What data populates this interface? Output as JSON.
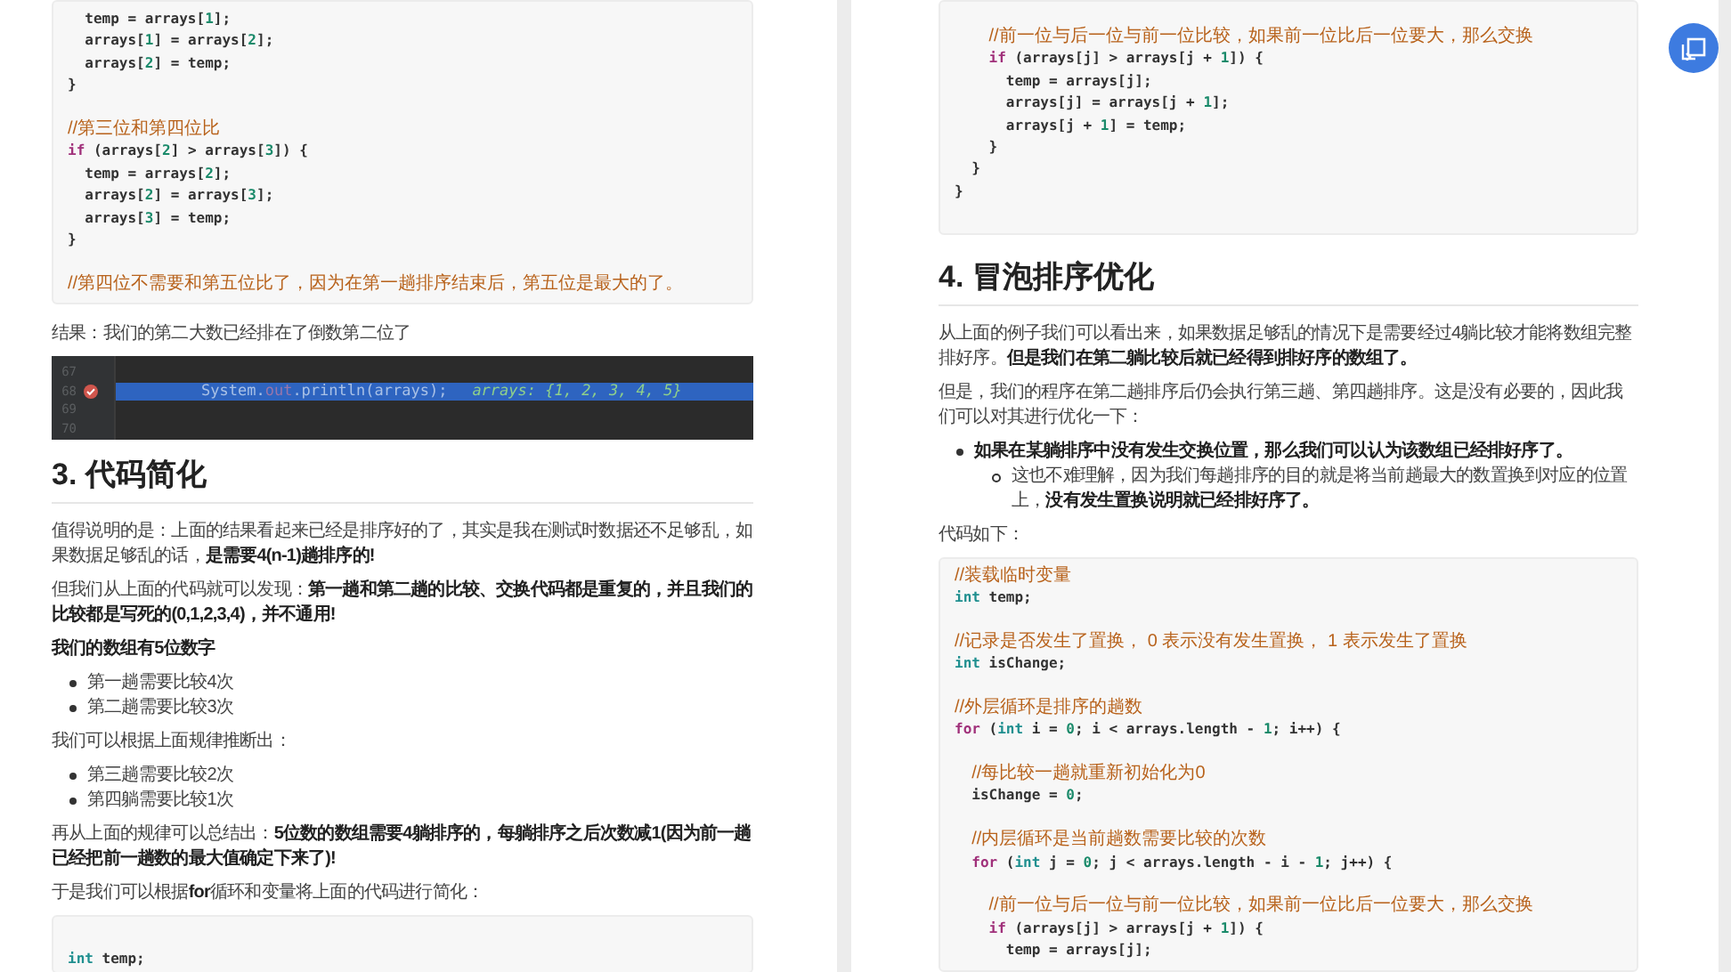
{
  "pages": [
    {
      "blocks": [
        {
          "kind": "code",
          "lines": [
            {
              "kind": "code",
              "tokens": [
                {
                  "kind": "plain",
                  "text": "  temp = arrays["
                },
                {
                  "kind": "num",
                  "text": "1"
                },
                {
                  "kind": "plain",
                  "text": "];"
                }
              ]
            },
            {
              "kind": "code",
              "tokens": [
                {
                  "kind": "plain",
                  "text": "  arrays["
                },
                {
                  "kind": "num",
                  "text": "1"
                },
                {
                  "kind": "plain",
                  "text": "] = arrays["
                },
                {
                  "kind": "num",
                  "text": "2"
                },
                {
                  "kind": "plain",
                  "text": "];"
                }
              ]
            },
            {
              "kind": "code",
              "tokens": [
                {
                  "kind": "plain",
                  "text": "  arrays["
                },
                {
                  "kind": "num",
                  "text": "2"
                },
                {
                  "kind": "plain",
                  "text": "] = temp;"
                }
              ]
            },
            {
              "kind": "code",
              "tokens": [
                {
                  "kind": "plain",
                  "text": "}"
                }
              ]
            },
            {
              "kind": "blank"
            },
            {
              "kind": "code",
              "tokens": [
                {
                  "kind": "comment",
                  "text": "//第三位和第四位比"
                }
              ]
            },
            {
              "kind": "code",
              "tokens": [
                {
                  "kind": "kw",
                  "text": "if"
                },
                {
                  "kind": "plain",
                  "text": " (arrays["
                },
                {
                  "kind": "num",
                  "text": "2"
                },
                {
                  "kind": "plain",
                  "text": "] > arrays["
                },
                {
                  "kind": "num",
                  "text": "3"
                },
                {
                  "kind": "plain",
                  "text": "]) {"
                }
              ]
            },
            {
              "kind": "code",
              "tokens": [
                {
                  "kind": "plain",
                  "text": "  temp = arrays["
                },
                {
                  "kind": "num",
                  "text": "2"
                },
                {
                  "kind": "plain",
                  "text": "];"
                }
              ]
            },
            {
              "kind": "code",
              "tokens": [
                {
                  "kind": "plain",
                  "text": "  arrays["
                },
                {
                  "kind": "num",
                  "text": "2"
                },
                {
                  "kind": "plain",
                  "text": "] = arrays["
                },
                {
                  "kind": "num",
                  "text": "3"
                },
                {
                  "kind": "plain",
                  "text": "];"
                }
              ]
            },
            {
              "kind": "code",
              "tokens": [
                {
                  "kind": "plain",
                  "text": "  arrays["
                },
                {
                  "kind": "num",
                  "text": "3"
                },
                {
                  "kind": "plain",
                  "text": "] = temp;"
                }
              ]
            },
            {
              "kind": "code",
              "tokens": [
                {
                  "kind": "plain",
                  "text": "}"
                }
              ]
            },
            {
              "kind": "blank"
            },
            {
              "kind": "code",
              "tokens": [
                {
                  "kind": "comment",
                  "text": "//第四位不需要和第五位比了，因为在第一趟排序结束后，第五位是最大的了。"
                }
              ]
            }
          ]
        },
        {
          "kind": "paragraph",
          "text": "结果：我们的第二大数已经排在了倒数第二位了"
        },
        {
          "kind": "editor",
          "lines": [
            {
              "number": "67",
              "breakpoint": false,
              "highlighted": false
            },
            {
              "number": "68",
              "breakpoint": true,
              "highlighted": true,
              "code": [
                {
                  "kind": "plain",
                  "text": "System."
                },
                {
                  "kind": "field",
                  "text": "out"
                },
                {
                  "kind": "plain",
                  "text": ".println(arrays);"
                }
              ],
              "value": "arrays: {1, 2, 3, 4, 5}"
            },
            {
              "number": "69",
              "breakpoint": false,
              "highlighted": false
            },
            {
              "number": "70",
              "breakpoint": false,
              "highlighted": false
            }
          ]
        },
        {
          "kind": "heading",
          "text": "3. 代码简化"
        },
        {
          "kind": "paragraph",
          "text": "值得说明的是：上面的结果看起来已经是排序好的了，其实是我在测试时数据还不足够乱，如果数据足够乱的话，**是需要4(n-1)趟排序的!**"
        },
        {
          "kind": "paragraph",
          "text": "但我们从上面的代码就可以发现：**第一趟和第二趟的比较、交换代码都是重复的，并且我们的比较都是写死的(0,1,2,3,4)，并不通用!**"
        },
        {
          "kind": "paragraph",
          "text": "**我们的数组有5位数字**"
        },
        {
          "kind": "list",
          "items": [
            {
              "text": "第一趟需要比较4次"
            },
            {
              "text": "第二趟需要比较3次"
            }
          ]
        },
        {
          "kind": "paragraph",
          "text": "我们可以根据上面规律推断出："
        },
        {
          "kind": "list",
          "items": [
            {
              "text": "第三趟需要比较2次"
            },
            {
              "text": "第四躺需要比较1次"
            }
          ]
        },
        {
          "kind": "paragraph",
          "text": "再从上面的规律可以总结出：**5位数的数组需要4躺排序的，每躺排序之后次数减1(因为前一趟已经把前一趟数的最大值确定下来了)!**"
        },
        {
          "kind": "paragraph",
          "text": "于是我们可以根据**for**循环和变量将上面的代码进行简化："
        },
        {
          "kind": "code",
          "lines": [
            {
              "kind": "blank"
            },
            {
              "kind": "code",
              "tokens": [
                {
                  "kind": "type",
                  "text": "int"
                },
                {
                  "kind": "plain",
                  "text": " temp;"
                }
              ]
            }
          ]
        }
      ]
    },
    {
      "blocks": [
        {
          "kind": "code",
          "lines": [
            {
              "kind": "code",
              "tokens": [
                {
                  "kind": "comment",
                  "text": "    //前一位与后一位与前一位比较，如果前一位比后一位要大，那么交换"
                }
              ]
            },
            {
              "kind": "code",
              "tokens": [
                {
                  "kind": "kw",
                  "text": "    if"
                },
                {
                  "kind": "plain",
                  "text": " (arrays[j] > arrays[j + "
                },
                {
                  "kind": "num",
                  "text": "1"
                },
                {
                  "kind": "plain",
                  "text": "]) {"
                }
              ]
            },
            {
              "kind": "code",
              "tokens": [
                {
                  "kind": "plain",
                  "text": "      temp = arrays[j];"
                }
              ]
            },
            {
              "kind": "code",
              "tokens": [
                {
                  "kind": "plain",
                  "text": "      arrays[j] = arrays[j + "
                },
                {
                  "kind": "num",
                  "text": "1"
                },
                {
                  "kind": "plain",
                  "text": "];"
                }
              ]
            },
            {
              "kind": "code",
              "tokens": [
                {
                  "kind": "plain",
                  "text": "      arrays[j + "
                },
                {
                  "kind": "num",
                  "text": "1"
                },
                {
                  "kind": "plain",
                  "text": "] = temp;"
                }
              ]
            },
            {
              "kind": "code",
              "tokens": [
                {
                  "kind": "plain",
                  "text": "    }"
                }
              ]
            },
            {
              "kind": "code",
              "tokens": [
                {
                  "kind": "plain",
                  "text": "  }"
                }
              ]
            },
            {
              "kind": "code",
              "tokens": [
                {
                  "kind": "plain",
                  "text": "}"
                }
              ]
            },
            {
              "kind": "blank"
            }
          ]
        },
        {
          "kind": "heading",
          "text": "4. 冒泡排序优化"
        },
        {
          "kind": "paragraph",
          "text": "从上面的例子我们可以看出来，如果数据足够乱的情况下是需要经过4躺比较才能将数组完整排好序。**但是我们在第二躺比较后就已经得到排好序的数组了。**"
        },
        {
          "kind": "paragraph",
          "text": "但是，我们的程序在第二趟排序后仍会执行第三趟、第四趟排序。这是没有必要的，因此我们可以对其进行优化一下："
        },
        {
          "kind": "list",
          "items": [
            {
              "text": "**如果在某躺排序中没有发生交换位置，那么我们可以认为该数组已经排好序了。**",
              "children": [
                {
                  "text": "这也不难理解，因为我们每趟排序的目的就是将当前趟最大的数置换到对应的位置上，**没有发生置换说明就已经排好序了。**"
                }
              ]
            }
          ]
        },
        {
          "kind": "paragraph",
          "text": "代码如下："
        },
        {
          "kind": "code",
          "lines": [
            {
              "kind": "code",
              "tokens": [
                {
                  "kind": "comment",
                  "text": "//装载临时变量"
                }
              ]
            },
            {
              "kind": "code",
              "tokens": [
                {
                  "kind": "type",
                  "text": "int"
                },
                {
                  "kind": "plain",
                  "text": " temp;"
                }
              ]
            },
            {
              "kind": "blank"
            },
            {
              "kind": "code",
              "tokens": [
                {
                  "kind": "comment",
                  "text": "//记录是否发生了置换， 0 表示没有发生置换， 1 表示发生了置换"
                }
              ]
            },
            {
              "kind": "code",
              "tokens": [
                {
                  "kind": "type",
                  "text": "int"
                },
                {
                  "kind": "plain",
                  "text": " isChange;"
                }
              ]
            },
            {
              "kind": "blank"
            },
            {
              "kind": "code",
              "tokens": [
                {
                  "kind": "comment",
                  "text": "//外层循环是排序的趟数"
                }
              ]
            },
            {
              "kind": "code",
              "tokens": [
                {
                  "kind": "kw",
                  "text": "for"
                },
                {
                  "kind": "plain",
                  "text": " ("
                },
                {
                  "kind": "type",
                  "text": "int"
                },
                {
                  "kind": "plain",
                  "text": " i = "
                },
                {
                  "kind": "num",
                  "text": "0"
                },
                {
                  "kind": "plain",
                  "text": "; i < arrays.length - "
                },
                {
                  "kind": "num",
                  "text": "1"
                },
                {
                  "kind": "plain",
                  "text": "; i++) {"
                }
              ]
            },
            {
              "kind": "blank"
            },
            {
              "kind": "code",
              "tokens": [
                {
                  "kind": "comment",
                  "text": "  //每比较一趟就重新初始化为0"
                }
              ]
            },
            {
              "kind": "code",
              "tokens": [
                {
                  "kind": "plain",
                  "text": "  isChange = "
                },
                {
                  "kind": "num",
                  "text": "0"
                },
                {
                  "kind": "plain",
                  "text": ";"
                }
              ]
            },
            {
              "kind": "blank"
            },
            {
              "kind": "code",
              "tokens": [
                {
                  "kind": "comment",
                  "text": "  //内层循环是当前趟数需要比较的次数"
                }
              ]
            },
            {
              "kind": "code",
              "tokens": [
                {
                  "kind": "kw",
                  "text": "  for"
                },
                {
                  "kind": "plain",
                  "text": " ("
                },
                {
                  "kind": "type",
                  "text": "int"
                },
                {
                  "kind": "plain",
                  "text": " j = "
                },
                {
                  "kind": "num",
                  "text": "0"
                },
                {
                  "kind": "plain",
                  "text": "; j < arrays.length - i - "
                },
                {
                  "kind": "num",
                  "text": "1"
                },
                {
                  "kind": "plain",
                  "text": "; j++) {"
                }
              ]
            },
            {
              "kind": "blank"
            },
            {
              "kind": "code",
              "tokens": [
                {
                  "kind": "comment",
                  "text": "    //前一位与后一位与前一位比较，如果前一位比后一位要大，那么交换"
                }
              ]
            },
            {
              "kind": "code",
              "tokens": [
                {
                  "kind": "kw",
                  "text": "    if"
                },
                {
                  "kind": "plain",
                  "text": " (arrays[j] > arrays[j + "
                },
                {
                  "kind": "num",
                  "text": "1"
                },
                {
                  "kind": "plain",
                  "text": "]) {"
                }
              ]
            },
            {
              "kind": "code",
              "tokens": [
                {
                  "kind": "plain",
                  "text": "      temp = arrays[j];"
                }
              ]
            }
          ]
        }
      ]
    }
  ]
}
